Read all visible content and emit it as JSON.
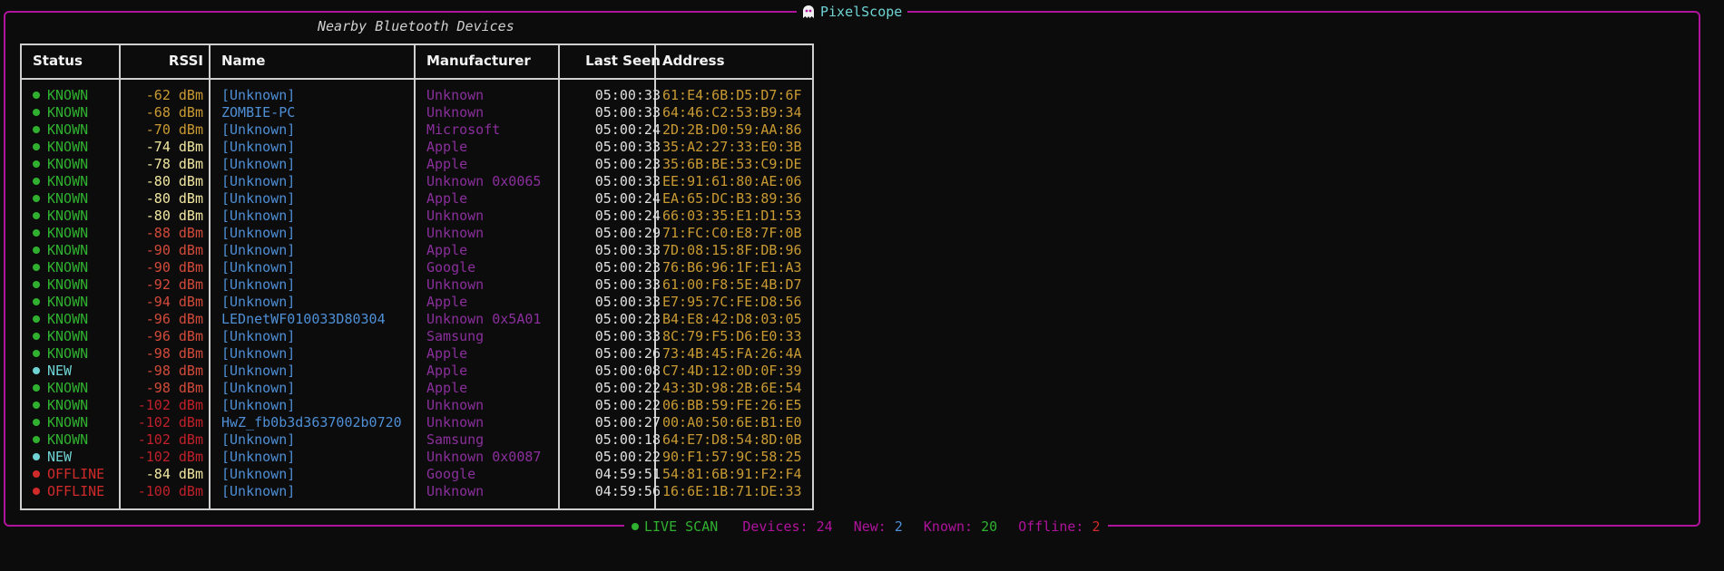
{
  "app": {
    "title": "PixelScope",
    "logo_icon": "ghost-icon"
  },
  "table": {
    "title": "Nearby Bluetooth Devices",
    "headers": {
      "status": "Status",
      "rssi": "RSSI",
      "name": "Name",
      "manufacturer": "Manufacturer",
      "last_seen": "Last Seen",
      "address": "Address"
    },
    "rows": [
      {
        "status": "KNOWN",
        "rssi": "-62 dBm",
        "name": "[Unknown]",
        "manufacturer": "Unknown",
        "last_seen": "05:00:33",
        "address": "61:E4:6B:D5:D7:6F"
      },
      {
        "status": "KNOWN",
        "rssi": "-68 dBm",
        "name": "ZOMBIE-PC",
        "manufacturer": "Unknown",
        "last_seen": "05:00:33",
        "address": "64:46:C2:53:B9:34"
      },
      {
        "status": "KNOWN",
        "rssi": "-70 dBm",
        "name": "[Unknown]",
        "manufacturer": "Microsoft",
        "last_seen": "05:00:24",
        "address": "2D:2B:D0:59:AA:86"
      },
      {
        "status": "KNOWN",
        "rssi": "-74 dBm",
        "name": "[Unknown]",
        "manufacturer": "Apple",
        "last_seen": "05:00:33",
        "address": "35:A2:27:33:E0:3B"
      },
      {
        "status": "KNOWN",
        "rssi": "-78 dBm",
        "name": "[Unknown]",
        "manufacturer": "Apple",
        "last_seen": "05:00:23",
        "address": "35:6B:BE:53:C9:DE"
      },
      {
        "status": "KNOWN",
        "rssi": "-80 dBm",
        "name": "[Unknown]",
        "manufacturer": "Unknown 0x0065",
        "last_seen": "05:00:33",
        "address": "EE:91:61:80:AE:06"
      },
      {
        "status": "KNOWN",
        "rssi": "-80 dBm",
        "name": "[Unknown]",
        "manufacturer": "Apple",
        "last_seen": "05:00:24",
        "address": "EA:65:DC:B3:89:36"
      },
      {
        "status": "KNOWN",
        "rssi": "-80 dBm",
        "name": "[Unknown]",
        "manufacturer": "Unknown",
        "last_seen": "05:00:24",
        "address": "66:03:35:E1:D1:53"
      },
      {
        "status": "KNOWN",
        "rssi": "-88 dBm",
        "name": "[Unknown]",
        "manufacturer": "Unknown",
        "last_seen": "05:00:29",
        "address": "71:FC:C0:E8:7F:0B"
      },
      {
        "status": "KNOWN",
        "rssi": "-90 dBm",
        "name": "[Unknown]",
        "manufacturer": "Apple",
        "last_seen": "05:00:33",
        "address": "7D:08:15:8F:DB:96"
      },
      {
        "status": "KNOWN",
        "rssi": "-90 dBm",
        "name": "[Unknown]",
        "manufacturer": "Google",
        "last_seen": "05:00:23",
        "address": "76:B6:96:1F:E1:A3"
      },
      {
        "status": "KNOWN",
        "rssi": "-92 dBm",
        "name": "[Unknown]",
        "manufacturer": "Unknown",
        "last_seen": "05:00:33",
        "address": "61:00:F8:5E:4B:D7"
      },
      {
        "status": "KNOWN",
        "rssi": "-94 dBm",
        "name": "[Unknown]",
        "manufacturer": "Apple",
        "last_seen": "05:00:33",
        "address": "E7:95:7C:FE:D8:56"
      },
      {
        "status": "KNOWN",
        "rssi": "-96 dBm",
        "name": "LEDnetWF010033D80304",
        "manufacturer": "Unknown 0x5A01",
        "last_seen": "05:00:23",
        "address": "B4:E8:42:D8:03:05"
      },
      {
        "status": "KNOWN",
        "rssi": "-96 dBm",
        "name": "[Unknown]",
        "manufacturer": "Samsung",
        "last_seen": "05:00:33",
        "address": "8C:79:F5:D6:E0:33"
      },
      {
        "status": "KNOWN",
        "rssi": "-98 dBm",
        "name": "[Unknown]",
        "manufacturer": "Apple",
        "last_seen": "05:00:26",
        "address": "73:4B:45:FA:26:4A"
      },
      {
        "status": "NEW",
        "rssi": "-98 dBm",
        "name": "[Unknown]",
        "manufacturer": "Apple",
        "last_seen": "05:00:08",
        "address": "C7:4D:12:0D:0F:39"
      },
      {
        "status": "KNOWN",
        "rssi": "-98 dBm",
        "name": "[Unknown]",
        "manufacturer": "Apple",
        "last_seen": "05:00:22",
        "address": "43:3D:98:2B:6E:54"
      },
      {
        "status": "KNOWN",
        "rssi": "-102 dBm",
        "name": "[Unknown]",
        "manufacturer": "Unknown",
        "last_seen": "05:00:22",
        "address": "06:BB:59:FE:26:E5"
      },
      {
        "status": "KNOWN",
        "rssi": "-102 dBm",
        "name": "HwZ_fb0b3d3637002b0720",
        "manufacturer": "Unknown",
        "last_seen": "05:00:27",
        "address": "00:A0:50:6E:B1:E0"
      },
      {
        "status": "KNOWN",
        "rssi": "-102 dBm",
        "name": "[Unknown]",
        "manufacturer": "Samsung",
        "last_seen": "05:00:18",
        "address": "64:E7:D8:54:8D:0B"
      },
      {
        "status": "NEW",
        "rssi": "-102 dBm",
        "name": "[Unknown]",
        "manufacturer": "Unknown 0x0087",
        "last_seen": "05:00:22",
        "address": "90:F1:57:9C:58:25"
      },
      {
        "status": "OFFLINE",
        "rssi": "-84 dBm",
        "name": "[Unknown]",
        "manufacturer": "Google",
        "last_seen": "04:59:51",
        "address": "54:81:6B:91:F2:F4"
      },
      {
        "status": "OFFLINE",
        "rssi": "-100 dBm",
        "name": "[Unknown]",
        "manufacturer": "Unknown",
        "last_seen": "04:59:56",
        "address": "16:6E:1B:71:DE:33"
      }
    ]
  },
  "footer": {
    "live_label": "LIVE SCAN",
    "devices_label": "Devices:",
    "devices_value": "24",
    "new_label": "New:",
    "new_value": "2",
    "known_label": "Known:",
    "known_value": "20",
    "offline_label": "Offline:",
    "offline_value": "2"
  },
  "colors": {
    "frame": "#b0139c",
    "title": "#6fd3d3",
    "known": "#2fb12f",
    "new": "#6fd3d3",
    "offline": "#d12a2a",
    "name": "#4e8fd6",
    "manufacturer": "#8a2f9c",
    "address": "#c99a32",
    "rssi_strong": "#c99a32",
    "rssi_mid": "#f0e6a0",
    "rssi_weak": "#d24a3a",
    "rssi_worst": "#c0202a"
  }
}
